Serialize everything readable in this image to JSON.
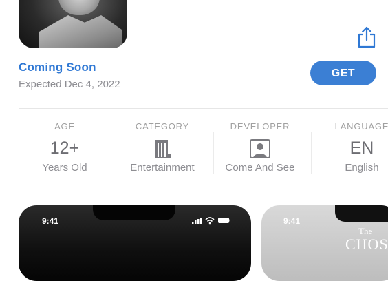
{
  "app": {
    "status_label": "Coming Soon",
    "expected_date": "Expected Dec 4, 2022",
    "get_label": "GET"
  },
  "info": [
    {
      "heading": "AGE",
      "value": "12+",
      "sub": "Years Old"
    },
    {
      "heading": "CATEGORY",
      "icon": "theater-icon",
      "sub": "Entertainment"
    },
    {
      "heading": "DEVELOPER",
      "icon": "person-icon",
      "sub": "Come And See"
    },
    {
      "heading": "LANGUAGE",
      "value": "EN",
      "sub": "English"
    }
  ],
  "screenshots": [
    {
      "time": "9:41"
    },
    {
      "time": "9:41",
      "title_small": "The",
      "title": "CHOSEN"
    }
  ],
  "colors": {
    "accent": "#2f78d4",
    "button": "#3b7fd4",
    "secondary_text": "#8e8e93"
  }
}
